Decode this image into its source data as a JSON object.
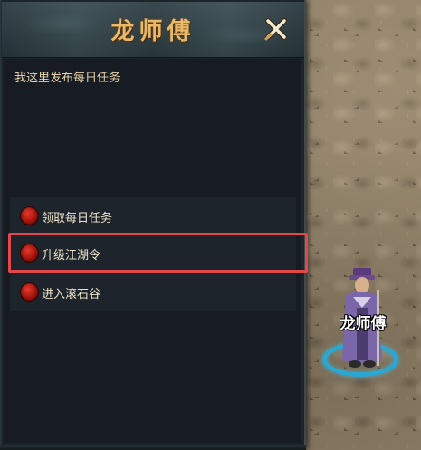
{
  "dialog": {
    "title": "龙师傅",
    "close_icon": "close-x-icon",
    "greeting": "我这里发布每日任务",
    "options": [
      {
        "label": "领取每日任务",
        "icon": "red-orb-icon"
      },
      {
        "label": "升级江湖令",
        "icon": "red-orb-icon",
        "highlighted": true
      },
      {
        "label": "进入滚石谷",
        "icon": "red-orb-icon"
      }
    ]
  },
  "npc": {
    "name": "龙师傅"
  },
  "colors": {
    "title": "#e8b96a",
    "highlight": "#e2484b",
    "npc_ring": "#29a8d4",
    "option_orb": "#a3140d"
  }
}
